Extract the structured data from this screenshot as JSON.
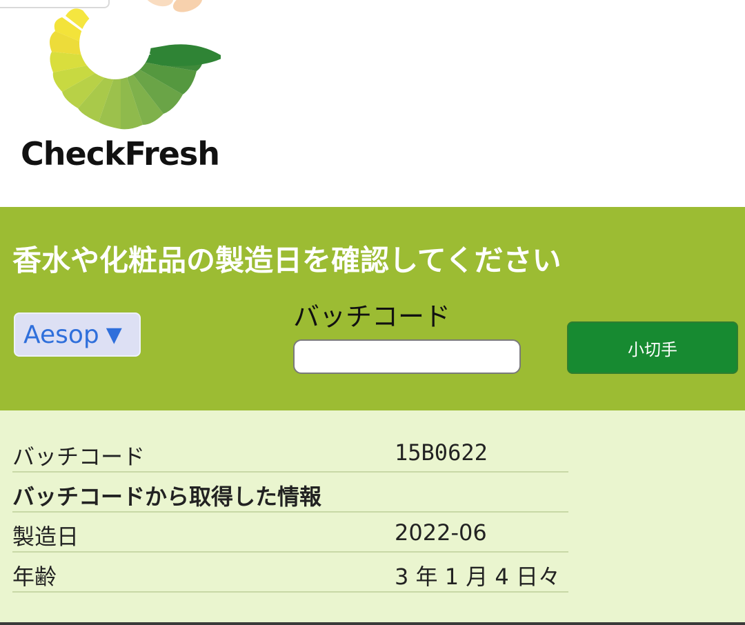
{
  "header": {
    "brand_name": "CheckFresh"
  },
  "form": {
    "title": "香水や化粧品の製造日を確認してください",
    "brand_select": {
      "selected": "Aesop",
      "arrow": "▼"
    },
    "batch_label": "バッチコード",
    "batch_input": {
      "value": "",
      "placeholder": ""
    },
    "check_button_label": "小切手"
  },
  "results": {
    "rows": [
      {
        "key": "バッチコード",
        "value": "15B0622"
      },
      {
        "key": "バッチコードから取得した情報",
        "value": ""
      },
      {
        "key": "製造日",
        "value": "2022-06"
      },
      {
        "key": "年齢",
        "value": "3 年 1 月 4 日々"
      }
    ]
  },
  "colors": {
    "form_band": "#9cbc33",
    "results_bg": "#eaf5cf",
    "check_button": "#178a31",
    "select_bg": "#dde0f4",
    "select_text": "#2f6fdb"
  },
  "icons": {
    "logo": "sunflower-logo-icon",
    "dropdown": "triangle-down-icon"
  }
}
